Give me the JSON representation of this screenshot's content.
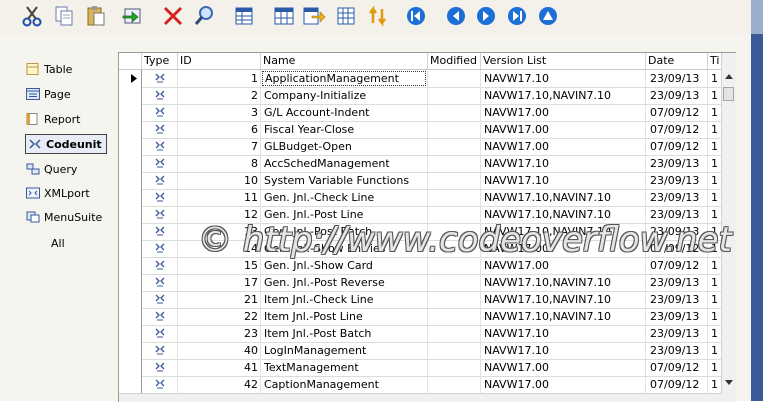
{
  "toolbar": {
    "buttons": [
      "cut",
      "copy",
      "paste",
      "import",
      "delete",
      "find",
      "design-table",
      "design-form",
      "export",
      "design-grid",
      "sort",
      "first",
      "previous",
      "next",
      "last",
      "more"
    ]
  },
  "sidebar": {
    "items": [
      {
        "label": "Table",
        "icon": "table-icon"
      },
      {
        "label": "Page",
        "icon": "page-icon"
      },
      {
        "label": "Report",
        "icon": "report-icon"
      },
      {
        "label": "Codeunit",
        "icon": "codeunit-icon",
        "active": true
      },
      {
        "label": "Query",
        "icon": "query-icon"
      },
      {
        "label": "XMLport",
        "icon": "xmlport-icon"
      },
      {
        "label": "MenuSuite",
        "icon": "menusuite-icon"
      },
      {
        "label": "All",
        "icon": ""
      }
    ]
  },
  "grid": {
    "headers": {
      "type": "Type",
      "id": "ID",
      "name": "Name",
      "modified": "Modified",
      "version": "Version List",
      "date": "Date",
      "time": "Ti"
    },
    "rows": [
      {
        "id": "1",
        "name": "ApplicationManagement",
        "modified": "",
        "version": "NAVW17.10",
        "date": "23/09/13",
        "time": "1"
      },
      {
        "id": "2",
        "name": "Company-Initialize",
        "modified": "",
        "version": "NAVW17.10,NAVIN7.10",
        "date": "23/09/13",
        "time": "1"
      },
      {
        "id": "3",
        "name": "G/L Account-Indent",
        "modified": "",
        "version": "NAVW17.00",
        "date": "07/09/12",
        "time": "1"
      },
      {
        "id": "6",
        "name": "Fiscal Year-Close",
        "modified": "",
        "version": "NAVW17.00",
        "date": "07/09/12",
        "time": "1"
      },
      {
        "id": "7",
        "name": "GLBudget-Open",
        "modified": "",
        "version": "NAVW17.00",
        "date": "07/09/12",
        "time": "1"
      },
      {
        "id": "8",
        "name": "AccSchedManagement",
        "modified": "",
        "version": "NAVW17.10",
        "date": "23/09/13",
        "time": "1"
      },
      {
        "id": "10",
        "name": "System Variable Functions",
        "modified": "",
        "version": "NAVW17.10",
        "date": "23/09/13",
        "time": "1"
      },
      {
        "id": "11",
        "name": "Gen. Jnl.-Check Line",
        "modified": "",
        "version": "NAVW17.10,NAVIN7.10",
        "date": "23/09/13",
        "time": "1"
      },
      {
        "id": "12",
        "name": "Gen. Jnl.-Post Line",
        "modified": "",
        "version": "NAVW17.10,NAVIN7.10",
        "date": "23/09/13",
        "time": "1"
      },
      {
        "id": "13",
        "name": "Gen. Jnl.-Post Batch",
        "modified": "",
        "version": "NAVW17.10,NAVIN7.10",
        "date": "23/09/13",
        "time": "1"
      },
      {
        "id": "14",
        "name": "Gen. Jnl.-Show Entries",
        "modified": "",
        "version": "NAVW17.00",
        "date": "07/09/12",
        "time": "1"
      },
      {
        "id": "15",
        "name": "Gen. Jnl.-Show Card",
        "modified": "",
        "version": "NAVW17.00",
        "date": "07/09/12",
        "time": "1"
      },
      {
        "id": "17",
        "name": "Gen. Jnl.-Post Reverse",
        "modified": "",
        "version": "NAVW17.10,NAVIN7.10",
        "date": "23/09/13",
        "time": "1"
      },
      {
        "id": "21",
        "name": "Item Jnl.-Check Line",
        "modified": "",
        "version": "NAVW17.10,NAVIN7.10",
        "date": "23/09/13",
        "time": "1"
      },
      {
        "id": "22",
        "name": "Item Jnl.-Post Line",
        "modified": "",
        "version": "NAVW17.10,NAVIN7.10",
        "date": "23/09/13",
        "time": "1"
      },
      {
        "id": "23",
        "name": "Item Jnl.-Post Batch",
        "modified": "",
        "version": "NAVW17.10",
        "date": "23/09/13",
        "time": "1"
      },
      {
        "id": "40",
        "name": "LogInManagement",
        "modified": "",
        "version": "NAVW17.10",
        "date": "23/09/13",
        "time": "1"
      },
      {
        "id": "41",
        "name": "TextManagement",
        "modified": "",
        "version": "NAVW17.00",
        "date": "07/09/12",
        "time": "1"
      },
      {
        "id": "42",
        "name": "CaptionManagement",
        "modified": "",
        "version": "NAVW17.00",
        "date": "07/09/12",
        "time": "1"
      }
    ]
  },
  "watermark": "© http://www.codeoverflow.net",
  "colors": {
    "accent": "#1c6fd6",
    "toolbar": "#f3f1ea",
    "selection": "#e8ecf6"
  }
}
